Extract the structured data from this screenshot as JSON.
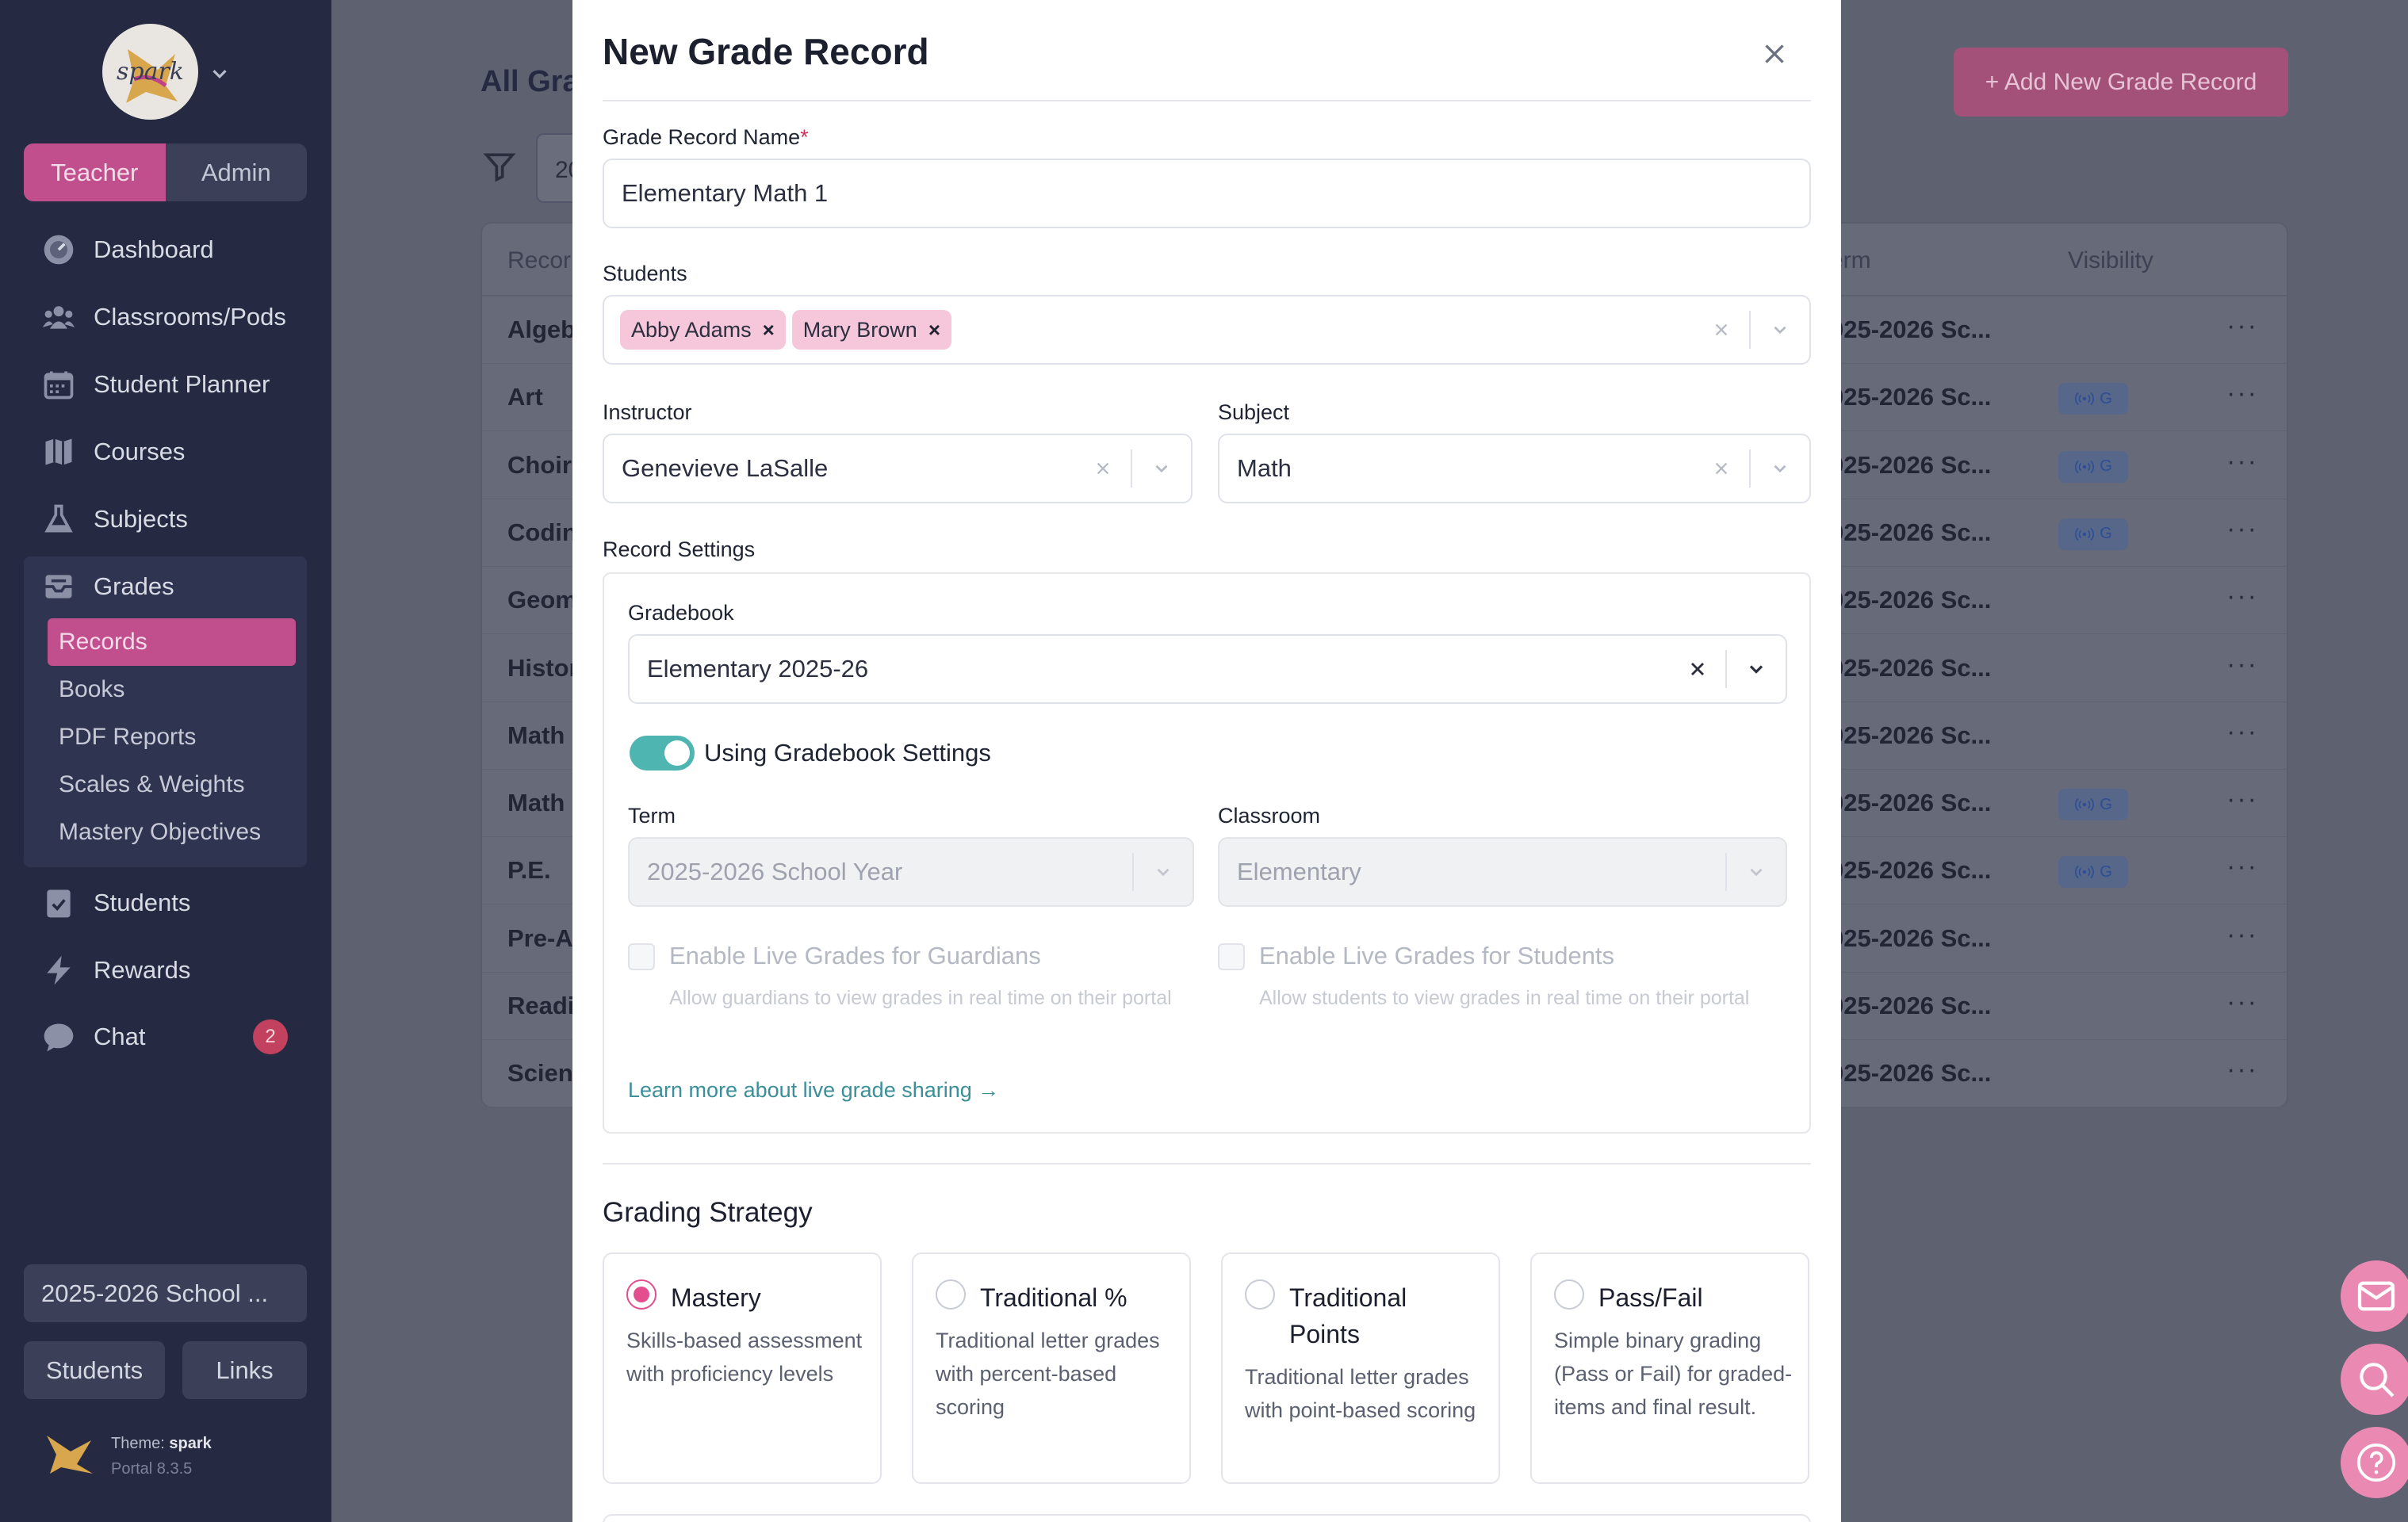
{
  "sidebar": {
    "logo_text": "spark",
    "roles": {
      "teacher": "Teacher",
      "admin": "Admin"
    },
    "nav": [
      {
        "label": "Dashboard",
        "icon": "dashboard-icon"
      },
      {
        "label": "Classrooms/Pods",
        "icon": "users-icon"
      },
      {
        "label": "Student Planner",
        "icon": "calendar-icon"
      },
      {
        "label": "Courses",
        "icon": "map-icon"
      },
      {
        "label": "Subjects",
        "icon": "flask-icon"
      },
      {
        "label": "Grades",
        "icon": "inbox-icon"
      },
      {
        "label": "Students",
        "icon": "clipboard-check-icon"
      },
      {
        "label": "Rewards",
        "icon": "bolt-icon"
      },
      {
        "label": "Chat",
        "icon": "chat-icon",
        "badge": "2"
      }
    ],
    "grades_sub": [
      "Records",
      "Books",
      "PDF Reports",
      "Scales & Weights",
      "Mastery Objectives"
    ],
    "year_button": "2025-2026 School ...",
    "bottom_buttons": {
      "students": "Students",
      "links": "Links"
    },
    "theme": {
      "label": "Theme:",
      "name": "spark",
      "version": "Portal 8.3.5"
    }
  },
  "main": {
    "title": "All Gra",
    "add_button": "+ Add New Grade Record",
    "filter_value": "20",
    "columns": {
      "record": "Recor",
      "term": "erm",
      "visibility": "Visibility"
    },
    "rows": [
      {
        "name": "Algeb",
        "term": "025-2026 Sc...",
        "visible": false
      },
      {
        "name": "Art",
        "term": "025-2026 Sc...",
        "visible": true
      },
      {
        "name": "Choir",
        "term": "025-2026 Sc...",
        "visible": true
      },
      {
        "name": "Codin",
        "term": "025-2026 Sc...",
        "visible": true
      },
      {
        "name": "Geom",
        "term": "025-2026 Sc...",
        "visible": false
      },
      {
        "name": "Histor",
        "term": "025-2026 Sc...",
        "visible": false
      },
      {
        "name": "Math",
        "term": "025-2026 Sc...",
        "visible": false
      },
      {
        "name": "Math",
        "term": "025-2026 Sc...",
        "visible": true
      },
      {
        "name": "P.E.",
        "term": "025-2026 Sc...",
        "visible": true
      },
      {
        "name": "Pre-A",
        "term": "025-2026 Sc...",
        "visible": false
      },
      {
        "name": "Readi",
        "term": "025-2026 Sc...",
        "visible": false
      },
      {
        "name": "Scien",
        "term": "025-2026 Sc...",
        "visible": false
      }
    ],
    "visibility_chip": "G",
    "row_menu": "···"
  },
  "modal": {
    "title": "New Grade Record",
    "record_name": {
      "label": "Grade Record Name",
      "required": "*",
      "value": "Elementary Math 1"
    },
    "students": {
      "label": "Students",
      "chips": [
        "Abby Adams",
        "Mary Brown"
      ],
      "chip_remove": "×"
    },
    "instructor": {
      "label": "Instructor",
      "value": "Genevieve LaSalle"
    },
    "subject": {
      "label": "Subject",
      "value": "Math"
    },
    "record_settings": {
      "label": "Record Settings",
      "gradebook_label": "Gradebook",
      "gradebook_value": "Elementary 2025-26",
      "toggle_label": "Using Gradebook Settings",
      "term_label": "Term",
      "term_value": "2025-2026 School Year",
      "classroom_label": "Classroom",
      "classroom_value": "Elementary",
      "guardians_label": "Enable Live Grades for Guardians",
      "guardians_help": "Allow guardians to view grades in real time on their portal",
      "students_label": "Enable Live Grades for Students",
      "students_help": "Allow students to view grades in real time on their portal",
      "learn_more": "Learn more about live grade sharing →"
    },
    "grading_strategy": {
      "title": "Grading Strategy",
      "options": [
        {
          "name": "Mastery",
          "desc": "Skills-based assessment with proficiency levels",
          "selected": true
        },
        {
          "name": "Traditional %",
          "desc": "Traditional letter grades with percent-based scoring",
          "selected": false
        },
        {
          "name": "Traditional Points",
          "desc": "Traditional letter grades with point-based scoring",
          "selected": false
        },
        {
          "name": "Pass/Fail",
          "desc": "Simple binary grading (Pass or Fail) for graded-items and final result.",
          "selected": false
        }
      ]
    }
  },
  "colors": {
    "accent": "#c24f8d",
    "teal": "#4fb5b1",
    "sidebar": "#252a42"
  }
}
